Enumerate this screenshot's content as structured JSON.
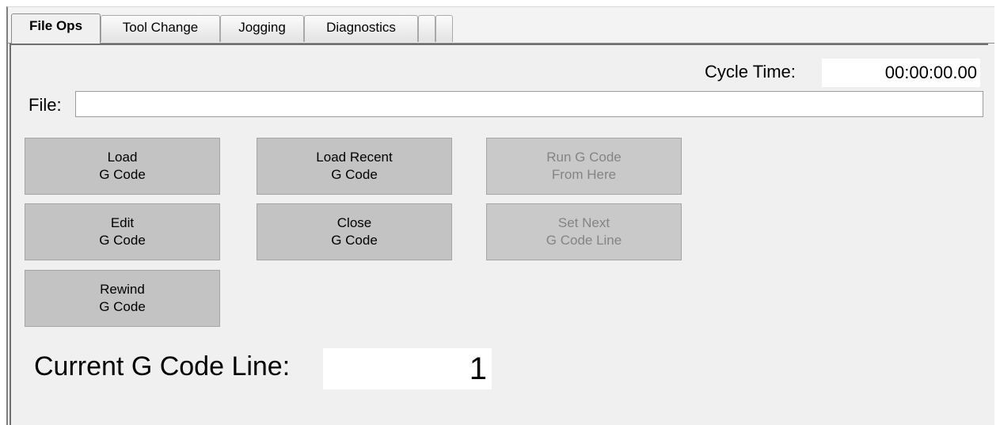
{
  "tabs": [
    {
      "label": "File Ops",
      "active": true
    },
    {
      "label": "Tool Change",
      "active": false
    },
    {
      "label": "Jogging",
      "active": false
    },
    {
      "label": "Diagnostics",
      "active": false
    },
    {
      "label": "",
      "active": false
    },
    {
      "label": "",
      "active": false
    }
  ],
  "cycle_time": {
    "label": "Cycle Time:",
    "value": "00:00:00.00"
  },
  "file": {
    "label": "File:",
    "value": ""
  },
  "buttons": {
    "load": {
      "line1": "Load",
      "line2": "G Code"
    },
    "load_recent": {
      "line1": "Load Recent",
      "line2": "G Code"
    },
    "run_from_here": {
      "line1": "Run G Code",
      "line2": "From Here",
      "enabled": false
    },
    "edit": {
      "line1": "Edit",
      "line2": "G Code"
    },
    "close": {
      "line1": "Close",
      "line2": "G Code"
    },
    "set_next_line": {
      "line1": "Set Next",
      "line2": "G Code Line",
      "enabled": false
    },
    "rewind": {
      "line1": "Rewind",
      "line2": "G Code"
    }
  },
  "current_line": {
    "label": "Current G Code Line:",
    "value": "1"
  },
  "colors": {
    "panel": "#f0f0f0",
    "button": "#c3c3c3",
    "disabled_text": "#848484"
  }
}
